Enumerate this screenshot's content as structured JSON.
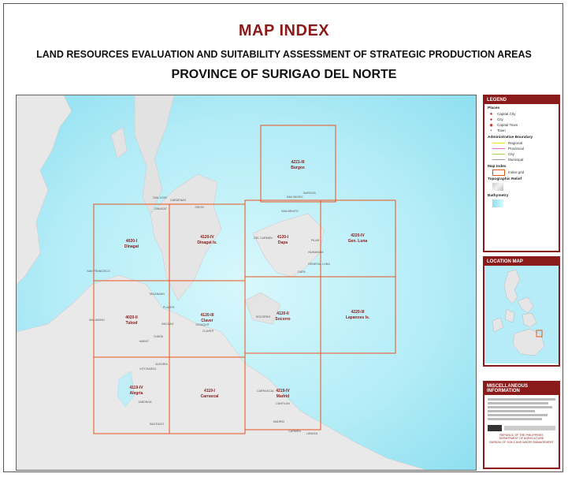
{
  "header": {
    "title": "MAP INDEX",
    "subtitle": "LAND RESOURCES EVALUATION AND SUITABILITY ASSESSMENT OF STRATEGIC PRODUCTION AREAS",
    "province": "PROVINCE OF SURIGAO DEL NORTE"
  },
  "map": {
    "sea_color": "#a3e6f4",
    "land_color": "#e6e6e6",
    "grid_color": "#e8551e",
    "sheets": [
      {
        "code": "4221-III",
        "name": "Burgos"
      },
      {
        "code": "4020-I",
        "name": "Dinagat"
      },
      {
        "code": "4120-IV",
        "name": "Dinagat Is."
      },
      {
        "code": "4120-I",
        "name": "Dapa"
      },
      {
        "code": "4220-IV",
        "name": "Gen. Luna"
      },
      {
        "code": "4020-II",
        "name": "Tubod"
      },
      {
        "code": "4120-III",
        "name": "Claver"
      },
      {
        "code": "4120-II",
        "name": "Socorro"
      },
      {
        "code": "4220-III",
        "name": "Lapanoss Is."
      },
      {
        "code": "4119-IV",
        "name": "Alegria"
      },
      {
        "code": "4119-I",
        "name": "Carrascal"
      },
      {
        "code": "4219-IV",
        "name": "Madrid"
      }
    ],
    "places": [
      "SAN JOSE",
      "CARDENAS",
      "DINAGAT",
      "SAN BENITO",
      "SAN ISIDRO",
      "BURGOS",
      "DEL CARMEN",
      "PILAR",
      "GENERAL LUNA",
      "DAPA",
      "SAN FRANCISCO",
      "TAGANAAN",
      "PLACER",
      "MALIMONO",
      "BACUAG",
      "GIGAQUIT",
      "CLAVER",
      "SOCORRO",
      "TUBOD",
      "MAINIT",
      "ALEGRIA",
      "KITCHARAO",
      "JABONGA",
      "SANTIAGO",
      "CARRASCAL",
      "CANTILAN",
      "MADRID",
      "CARMEN",
      "LANUZA",
      "SISON",
      "NUMANCIA"
    ]
  },
  "legend": {
    "title": "LEGEND",
    "places_heading": "Places",
    "places": [
      "Capital City",
      "City",
      "Capital Town",
      "Town"
    ],
    "boundary_heading": "Administrative Boundary",
    "boundaries": [
      "Regional",
      "Provincial",
      "City",
      "Municipal"
    ],
    "boundary_colors": [
      "#f5e600",
      "#e06ad0",
      "#9cd84a",
      "#9a9a9a"
    ],
    "index_heading": "Map Index",
    "index_label": "Index grid",
    "relief_heading": "Topographic Relief",
    "bathy_heading": "Bathymetry"
  },
  "location_map": {
    "title": "LOCATION MAP"
  },
  "misc": {
    "title": "MISCELLANEOUS INFORMATION",
    "agency_lines": [
      "REPUBLIC OF THE PHILIPPINES",
      "DEPARTMENT OF AGRICULTURE",
      "BUREAU OF SOILS AND WATER MANAGEMENT"
    ]
  }
}
